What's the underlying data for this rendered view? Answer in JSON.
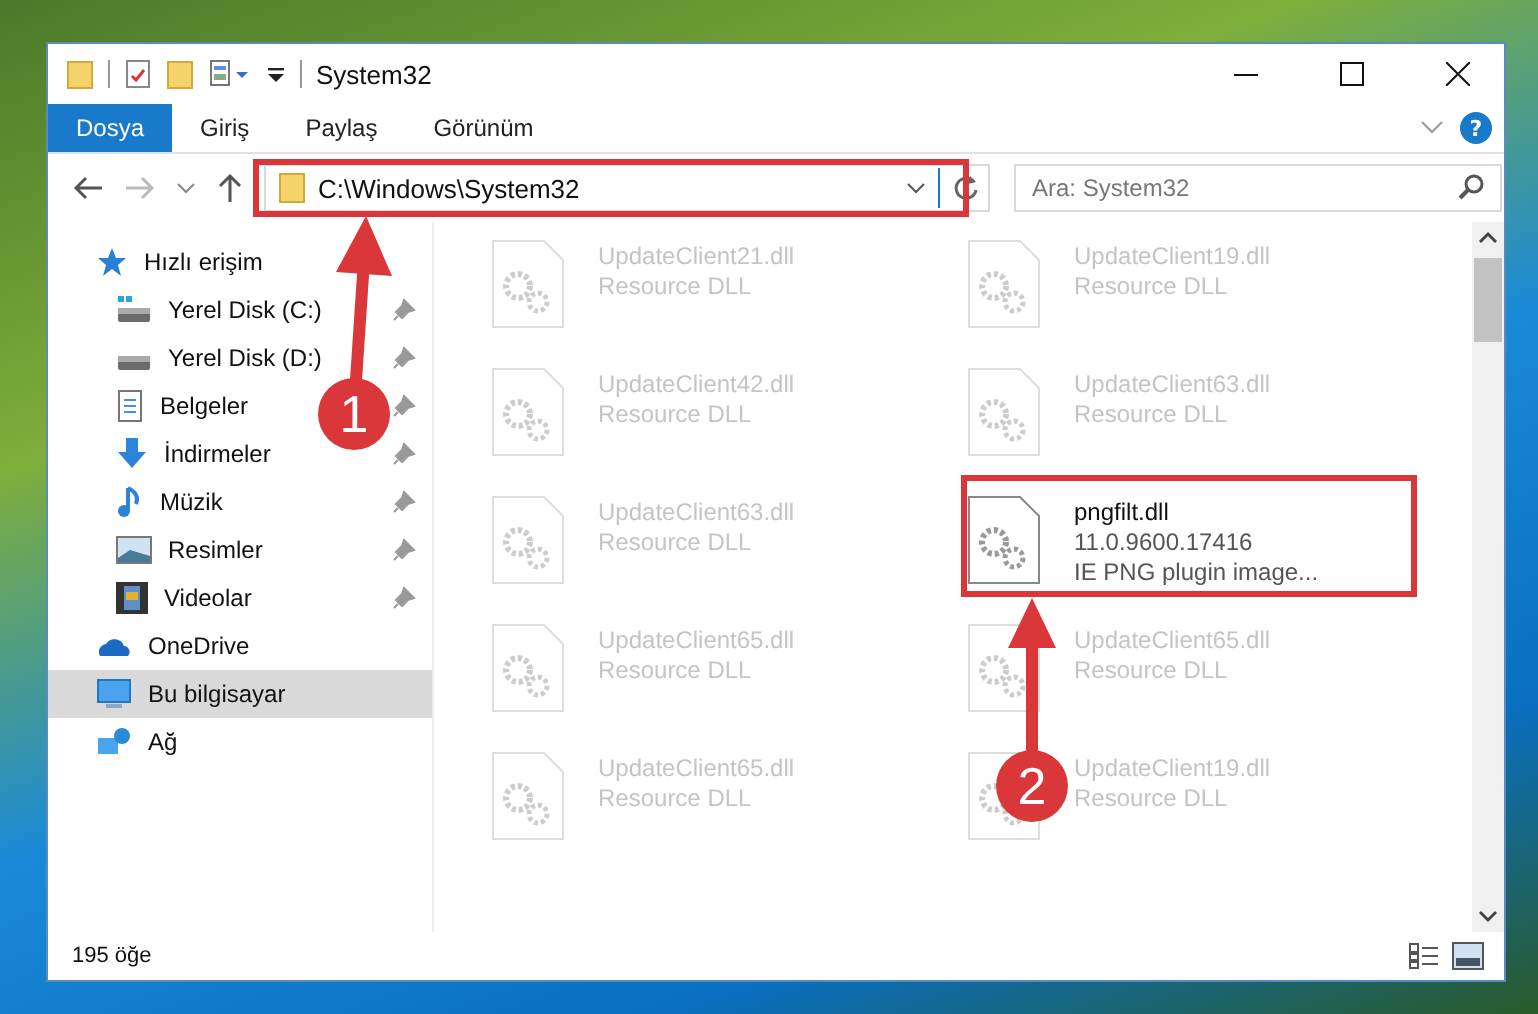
{
  "window": {
    "title": "System32"
  },
  "ribbon_tabs": [
    {
      "label": "Dosya",
      "selected": true
    },
    {
      "label": "Giriş",
      "selected": false
    },
    {
      "label": "Paylaş",
      "selected": false
    },
    {
      "label": "Görünüm",
      "selected": false
    }
  ],
  "help_button": "?",
  "address_bar": {
    "path": "C:\\Windows\\System32"
  },
  "search": {
    "placeholder": "Ara: System32"
  },
  "sidebar": {
    "items": [
      {
        "label": "Hızlı erişim",
        "kind": "star",
        "selected": false,
        "children": [
          {
            "label": "Yerel Disk (C:)",
            "kind": "system-drive",
            "pinned": true,
            "selected": false
          },
          {
            "label": "Yerel Disk (D:)",
            "kind": "drive",
            "pinned": true,
            "selected": false
          },
          {
            "label": "Belgeler",
            "kind": "document",
            "pinned": true,
            "selected": false
          },
          {
            "label": "İndirmeler",
            "kind": "download",
            "pinned": true,
            "selected": false
          },
          {
            "label": "Müzik",
            "kind": "music",
            "pinned": true,
            "selected": false
          },
          {
            "label": "Resimler",
            "kind": "pictures",
            "pinned": true,
            "selected": false
          },
          {
            "label": "Videolar",
            "kind": "videos",
            "pinned": true,
            "selected": false
          }
        ]
      },
      {
        "label": "OneDrive",
        "kind": "cloud",
        "selected": false
      },
      {
        "label": "Bu bilgisayar",
        "kind": "computer",
        "selected": true
      },
      {
        "label": "Ağ",
        "kind": "network",
        "selected": false
      }
    ]
  },
  "files": [
    {
      "name": "UpdateClient21.dll",
      "lines": [
        "Resource DLL"
      ],
      "dimmed": true
    },
    {
      "name": "UpdateClient19.dll",
      "lines": [
        "Resource DLL"
      ],
      "dimmed": true
    },
    {
      "name": "UpdateClient42.dll",
      "lines": [
        "Resource DLL"
      ],
      "dimmed": true
    },
    {
      "name": "UpdateClient63.dll",
      "lines": [
        "Resource DLL"
      ],
      "dimmed": true
    },
    {
      "name": "UpdateClient63.dll",
      "lines": [
        "Resource DLL"
      ],
      "dimmed": true
    },
    {
      "name": "pngfilt.dll",
      "lines": [
        "11.0.9600.17416",
        "IE PNG plugin image..."
      ],
      "dimmed": false
    },
    {
      "name": "UpdateClient65.dll",
      "lines": [
        "Resource DLL"
      ],
      "dimmed": true
    },
    {
      "name": "UpdateClient65.dll",
      "lines": [
        "Resource DLL"
      ],
      "dimmed": true
    },
    {
      "name": "UpdateClient65.dll",
      "lines": [
        "Resource DLL"
      ],
      "dimmed": true
    },
    {
      "name": "UpdateClient19.dll",
      "lines": [
        "Resource DLL"
      ],
      "dimmed": true
    }
  ],
  "status_bar": {
    "count": "195 öğe"
  },
  "annotations": [
    {
      "label": "1"
    },
    {
      "label": "2"
    }
  ]
}
